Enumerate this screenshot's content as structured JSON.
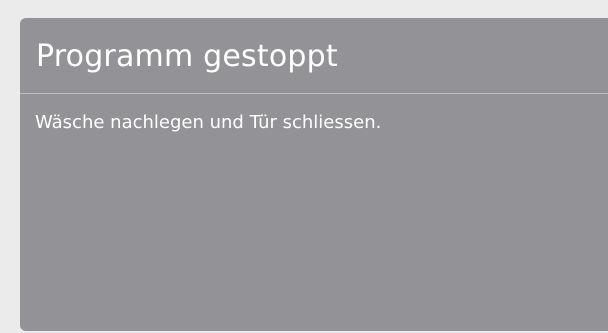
{
  "dialog": {
    "title": "Programm gestoppt",
    "message": "Wäsche nachlegen und Tür schliessen."
  },
  "colors": {
    "background": "#ebebeb",
    "panel": "#929297",
    "divider": "#bdbdc1",
    "text": "#ffffff"
  }
}
